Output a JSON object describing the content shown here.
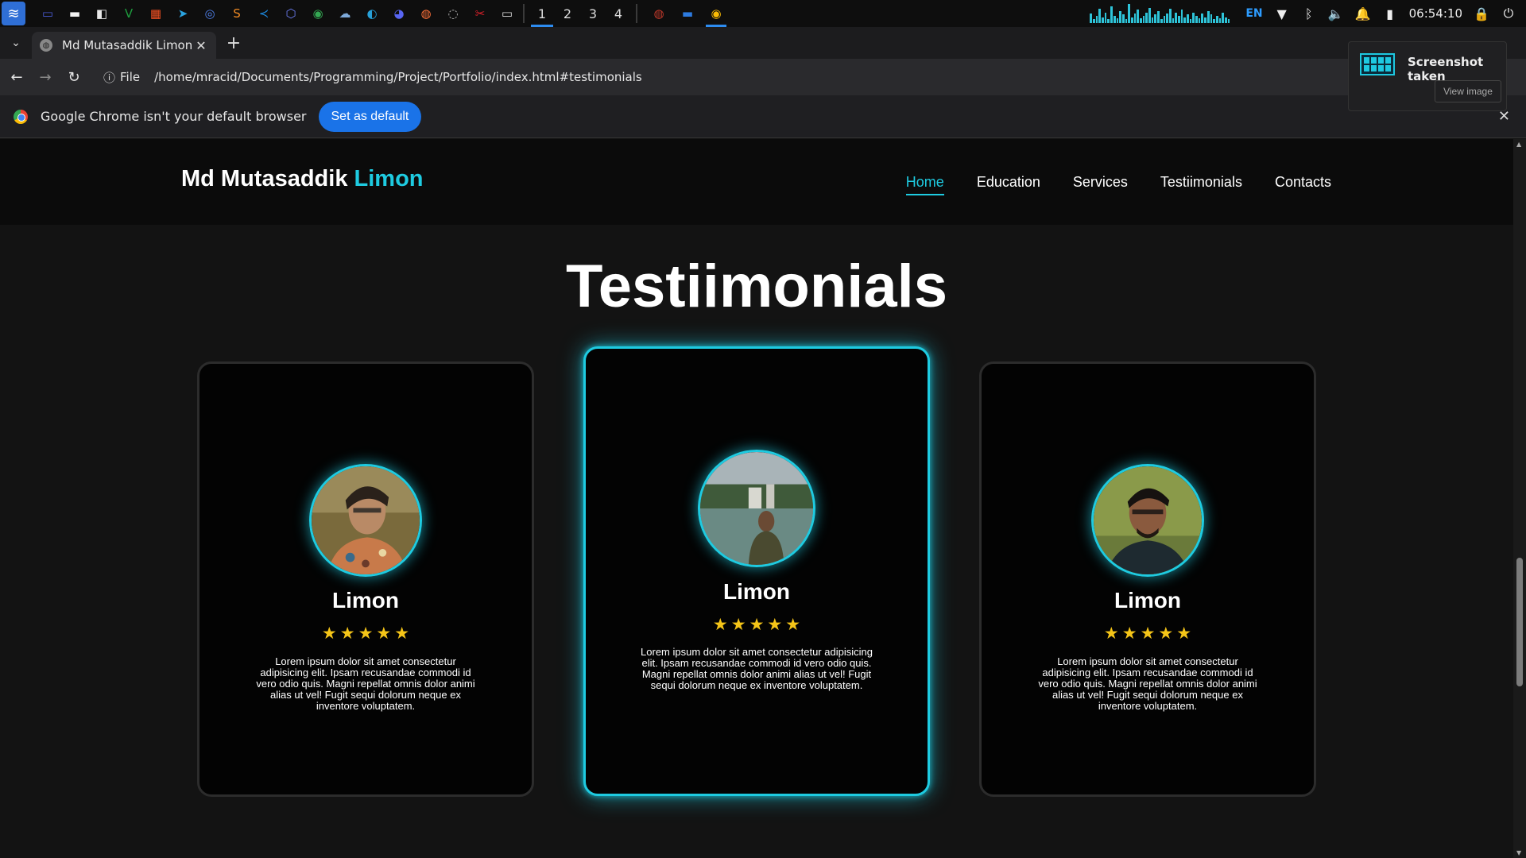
{
  "taskbar": {
    "launcher_icon": "distro-launcher-icon",
    "pinned_apps": [
      {
        "name": "desktop-icon",
        "glyph": "▭",
        "color": "#4a5bd6"
      },
      {
        "name": "files-icon",
        "glyph": "▬",
        "color": "#f2f2f2"
      },
      {
        "name": "document-icon",
        "glyph": "◧",
        "color": "#e8e8e8"
      },
      {
        "name": "vim-icon",
        "glyph": "V",
        "color": "#1e9e3e"
      },
      {
        "name": "windows-icon",
        "glyph": "▦",
        "color": "#f25022"
      },
      {
        "name": "telegram-icon",
        "glyph": "➤",
        "color": "#2aa3e0"
      },
      {
        "name": "chromium-icon",
        "glyph": "◎",
        "color": "#4f7fe8"
      },
      {
        "name": "sublime-icon",
        "glyph": "S",
        "color": "#f08a24"
      },
      {
        "name": "vscode-icon",
        "glyph": "≺",
        "color": "#1c8ae0"
      },
      {
        "name": "app-cube-icon",
        "glyph": "⬡",
        "color": "#6b7cf0"
      },
      {
        "name": "chrome-icon",
        "glyph": "◉",
        "color": "#34a853"
      },
      {
        "name": "cloud-icon",
        "glyph": "☁",
        "color": "#7ea9d8"
      },
      {
        "name": "edge-icon",
        "glyph": "◐",
        "color": "#27a0d8"
      },
      {
        "name": "discord-icon",
        "glyph": "◕",
        "color": "#5865f2"
      },
      {
        "name": "firefox-icon",
        "glyph": "◍",
        "color": "#ff7139"
      },
      {
        "name": "obs-icon",
        "glyph": "◌",
        "color": "#bbbbbb"
      },
      {
        "name": "screenshot-tool-icon",
        "glyph": "✂",
        "color": "#d9202a"
      },
      {
        "name": "terminal-icon",
        "glyph": "▭",
        "color": "#dddddd"
      }
    ],
    "workspaces": [
      "1",
      "2",
      "3",
      "4"
    ],
    "active_workspace": 0,
    "running_apps": [
      {
        "name": "firefox-running-icon",
        "glyph": "◍",
        "color": "#c0392b"
      },
      {
        "name": "files-running-icon",
        "glyph": "▬",
        "color": "#2d7be0"
      },
      {
        "name": "chrome-running-icon",
        "glyph": "◉",
        "color": "#fbbc05"
      }
    ],
    "language": "EN",
    "tray_icons": [
      "wifi-icon",
      "bluetooth-icon",
      "volume-icon",
      "notification-bell-icon",
      "battery-icon"
    ],
    "tray_glyphs": [
      "▼",
      "ᛒ",
      "🔈",
      "🔔",
      "▮"
    ],
    "clock": "06:54:10",
    "lock_icon": "lock-icon",
    "lock_glyph": "🔒",
    "power_icon": "power-icon",
    "power_glyph": "⏻",
    "cpu_graph": [
      8,
      3,
      6,
      12,
      5,
      9,
      3,
      14,
      6,
      4,
      10,
      7,
      3,
      16,
      5,
      8,
      11,
      4,
      6,
      9,
      13,
      5,
      7,
      10,
      3,
      6,
      8,
      12,
      4,
      9,
      6,
      11,
      5,
      7,
      3,
      9,
      6,
      4,
      8,
      5,
      10,
      7,
      3,
      6,
      4,
      9,
      5,
      3
    ]
  },
  "browser": {
    "tab_title": "Md Mutasaddik Limon",
    "new_tab_label": "+",
    "close_glyph": "✕",
    "tab_list_glyph": "⌄",
    "back_glyph": "←",
    "forward_glyph": "→",
    "reload_glyph": "↻",
    "info_glyph": "ⓘ",
    "scheme_label": "File",
    "url": "/home/mracid/Documents/Programming/Project/Portfolio/index.html#testimonials",
    "infobar_text": "Google Chrome isn't your default browser",
    "set_default_label": "Set as default",
    "infobar_close": "✕"
  },
  "notification": {
    "title": "Screenshot taken",
    "button": "View image"
  },
  "site": {
    "logo_main": "Md Mutasaddik ",
    "logo_accent": "Limon",
    "nav": [
      "Home",
      "Education",
      "Services",
      "Testiimonials",
      "Contacts"
    ],
    "active_nav": 0,
    "section_title": "Testiimonials",
    "accent_color": "#1ecbe1",
    "star_color": "#f5c518",
    "testimonials": [
      {
        "name": "Limon",
        "rating": 5,
        "text": "Lorem ipsum dolor sit amet consectetur adipisicing elit. Ipsam recusandae commodi id vero odio quis. Magni repellat omnis dolor animi alias ut vel! Fugit sequi dolorum neque ex inventore voluptatem."
      },
      {
        "name": "Limon",
        "rating": 5,
        "text": "Lorem ipsum dolor sit amet consectetur adipisicing elit. Ipsam recusandae commodi id vero odio quis. Magni repellat omnis dolor animi alias ut vel! Fugit sequi dolorum neque ex inventore voluptatem."
      },
      {
        "name": "Limon",
        "rating": 5,
        "text": "Lorem ipsum dolor sit amet consectetur adipisicing elit. Ipsam recusandae commodi id vero odio quis. Magni repellat omnis dolor animi alias ut vel! Fugit sequi dolorum neque ex inventore voluptatem."
      }
    ]
  }
}
